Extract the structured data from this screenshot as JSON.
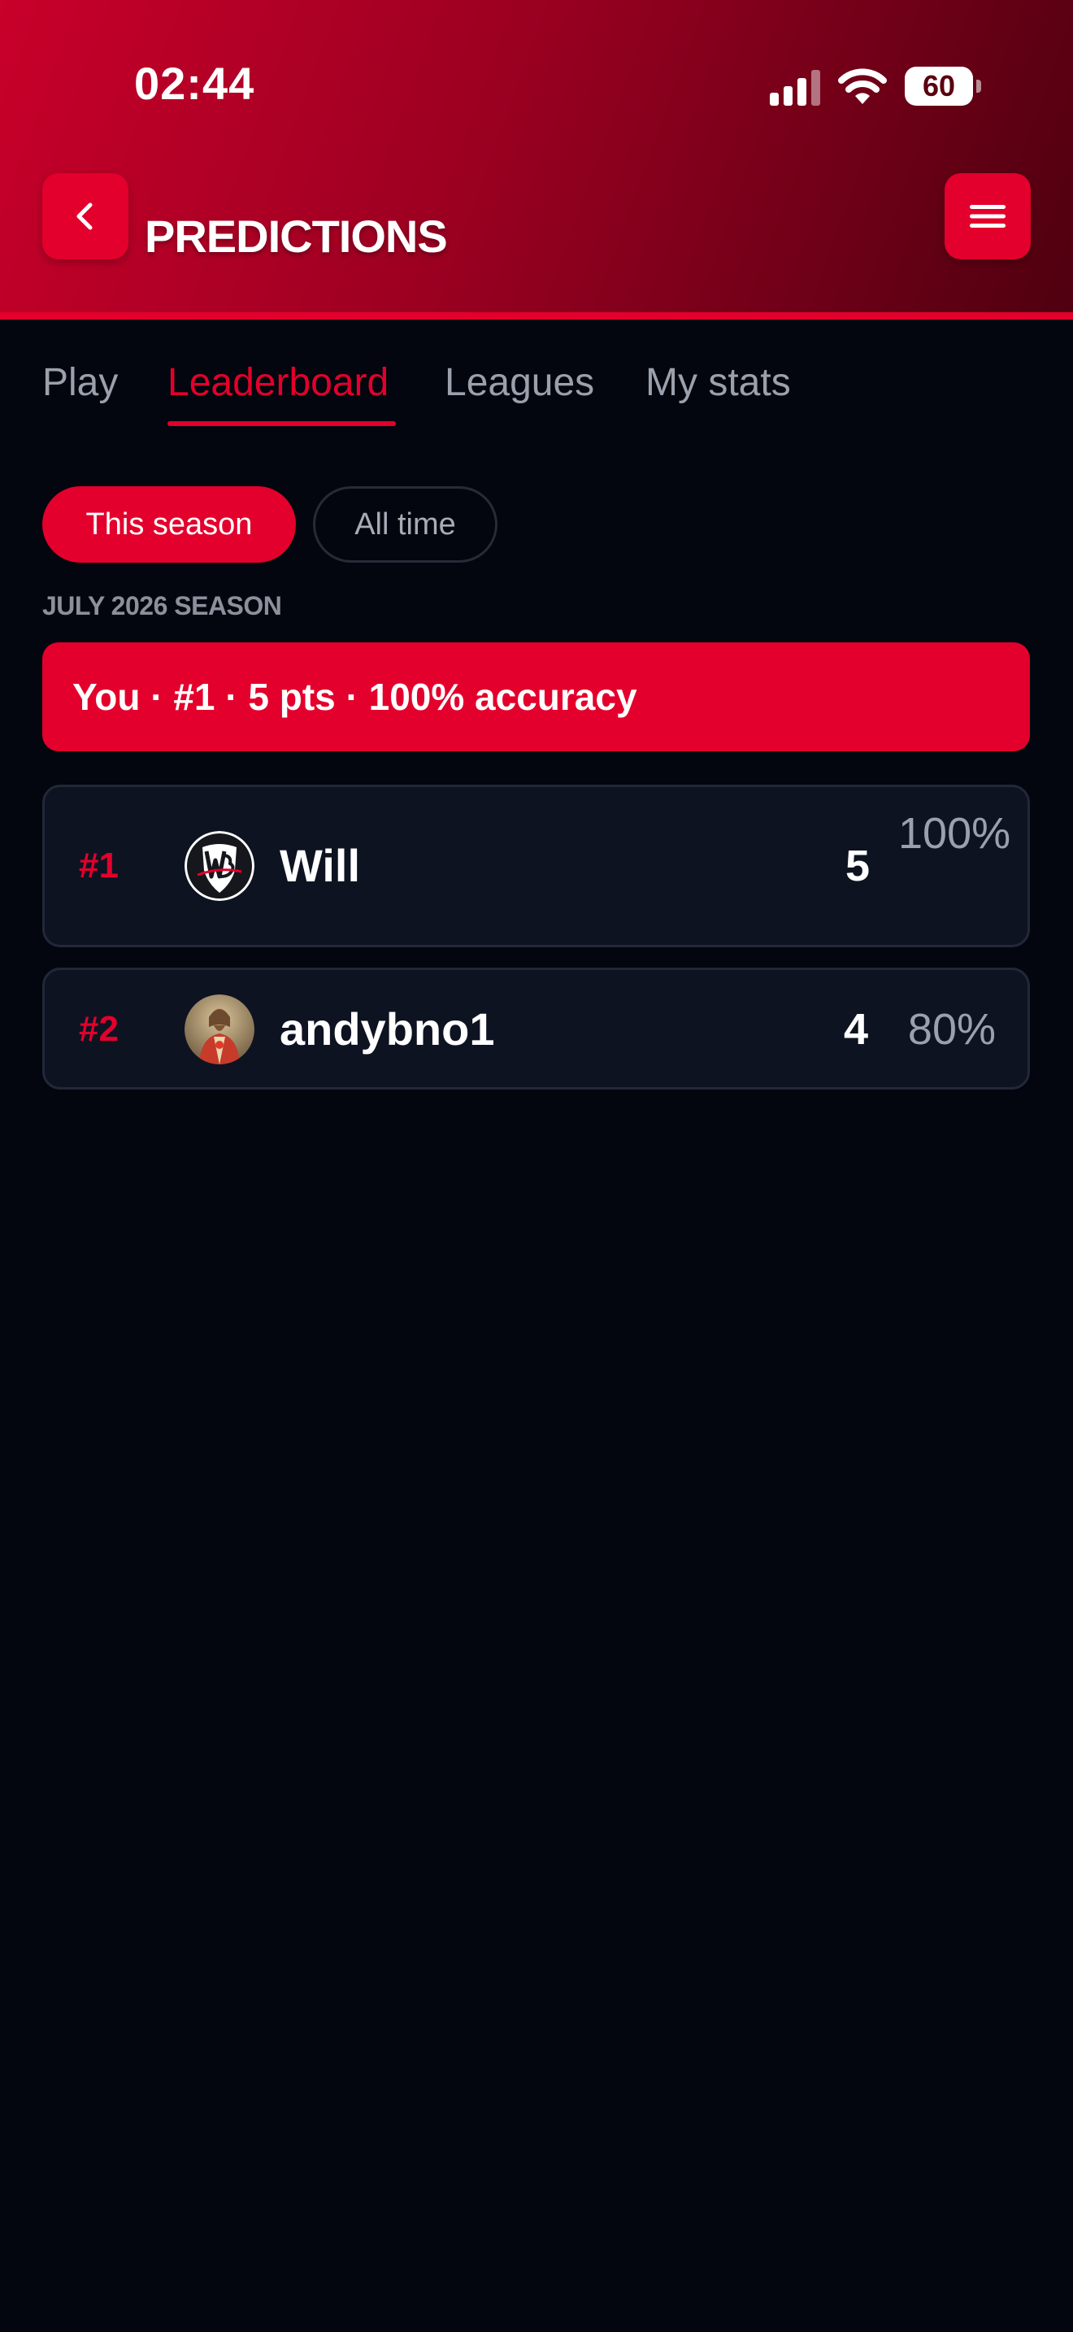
{
  "status_bar": {
    "time": "02:44",
    "battery_level": "60",
    "battery_fraction": 0.6
  },
  "header": {
    "title": "PREDICTIONS",
    "back_icon": "chevron-left-icon",
    "menu_icon": "hamburger-menu-icon"
  },
  "tabs": [
    {
      "label": "Play",
      "active": false
    },
    {
      "label": "Leaderboard",
      "active": true
    },
    {
      "label": "Leagues",
      "active": false
    },
    {
      "label": "My stats",
      "active": false
    }
  ],
  "filters": [
    {
      "label": "This season",
      "active": true
    },
    {
      "label": "All time",
      "active": false
    }
  ],
  "season_label": "JULY 2026 SEASON",
  "summary": {
    "text": "You · #1 · 5 pts · 100% accuracy"
  },
  "leaderboard": [
    {
      "rank": "#1",
      "name": "Will",
      "points": "5",
      "accuracy": "100%"
    },
    {
      "rank": "#2",
      "name": "andybno1",
      "points": "4",
      "accuracy": "80%"
    }
  ],
  "colors": {
    "accent": "#e3002c",
    "background": "#03060e",
    "row_background": "#0e1322",
    "muted_text": "#9aa0ac"
  }
}
